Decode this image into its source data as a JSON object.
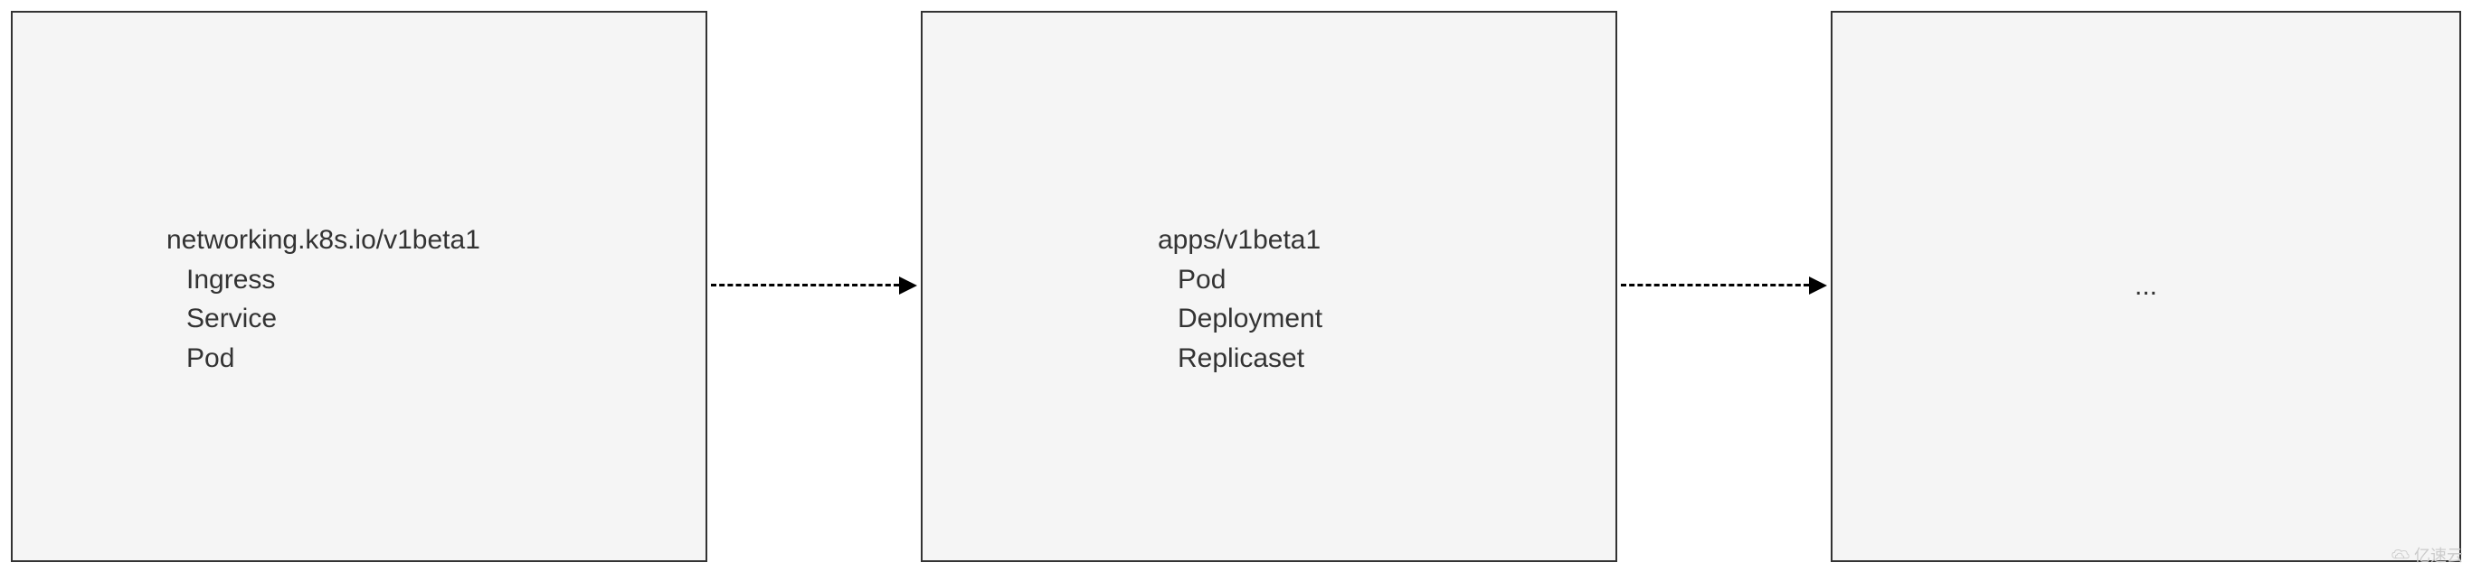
{
  "boxes": {
    "box1": {
      "header": "networking.k8s.io/v1beta1",
      "items": [
        "Ingress",
        "Service",
        "Pod"
      ]
    },
    "box2": {
      "header": "apps/v1beta1",
      "items": [
        "Pod",
        "Deployment",
        "Replicaset"
      ]
    },
    "box3": {
      "text": "..."
    }
  },
  "watermark": {
    "text": "亿速云"
  }
}
